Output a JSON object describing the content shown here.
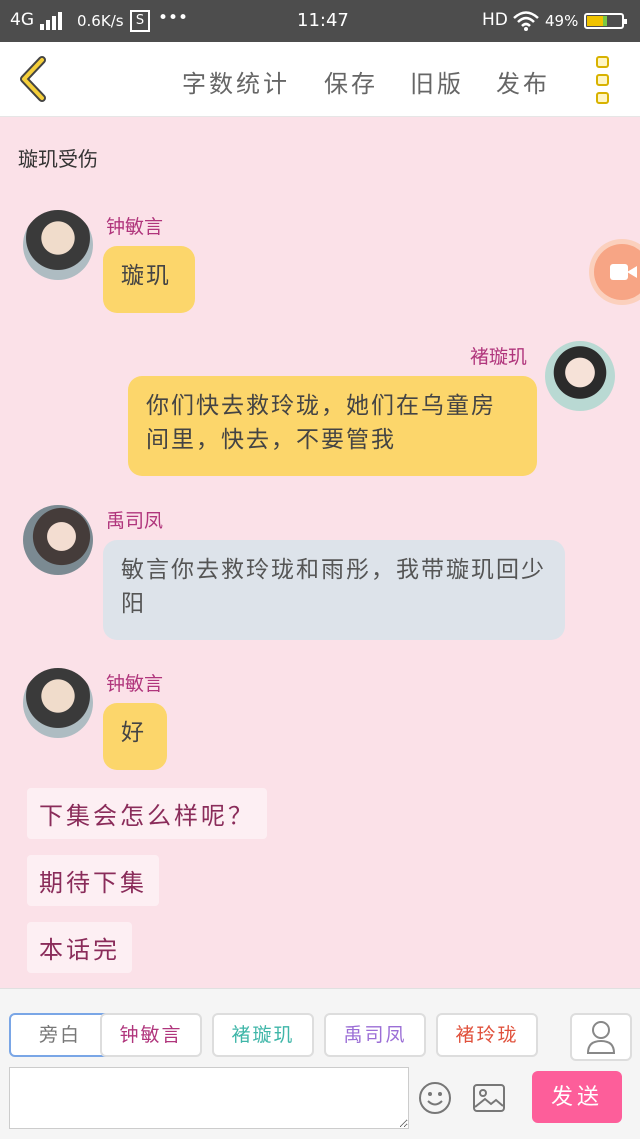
{
  "status_bar": {
    "network": "4G",
    "speed": "0.6K/s",
    "app_badge": "S",
    "dots": "•••",
    "time": "11:47",
    "hd": "HD",
    "battery_pct": "49%",
    "battery_level": 0.49
  },
  "header": {
    "buttons": [
      "字数统计",
      "保存",
      "旧版",
      "发布"
    ]
  },
  "scene_title": "璇玑受伤",
  "messages": [
    {
      "speaker": "钟敏言",
      "text": "璇玑",
      "side": "left",
      "style": "yellow"
    },
    {
      "speaker": "褚璇玑",
      "text": "你们快去救玲珑，她们在乌童房间里，快去，不要管我",
      "side": "right",
      "style": "yellow"
    },
    {
      "speaker": "禹司凤",
      "text": "敏言你去救玲珑和雨彤，我带璇玑回少阳",
      "side": "left",
      "style": "gray"
    },
    {
      "speaker": "钟敏言",
      "text": "好",
      "side": "left",
      "style": "yellow"
    }
  ],
  "narrations": [
    "下集会怎么样呢？",
    "期待下集",
    "本话完"
  ],
  "bottom_bar": {
    "roles": [
      {
        "label": "旁白",
        "color": "#888888",
        "selected": true
      },
      {
        "label": "钟敏言",
        "color": "#b0357c",
        "selected": false
      },
      {
        "label": "褚璇玑",
        "color": "#3fb6a8",
        "selected": false
      },
      {
        "label": "禹司凤",
        "color": "#9b6ed6",
        "selected": false
      },
      {
        "label": "褚玲珑",
        "color": "#e0513c",
        "selected": false
      }
    ],
    "input_value": "",
    "send_label": "发送"
  },
  "colors": {
    "background": "#fbe1e8",
    "accent": "#fd5e9a",
    "bubble_yellow": "#fcd66b",
    "bubble_gray": "#dde3ea"
  }
}
